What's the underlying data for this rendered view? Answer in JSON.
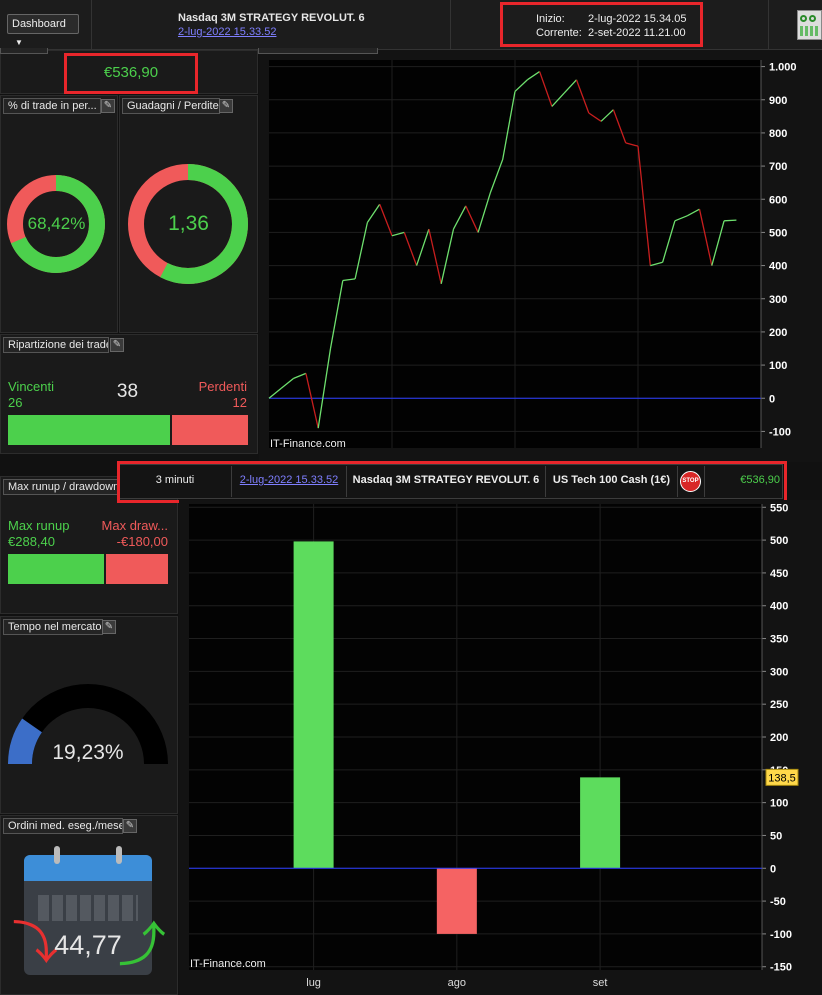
{
  "header": {
    "dashboard_label": "Dashboard",
    "strategy_name": "Nasdaq 3M STRATEGY REVOLUT. 6",
    "strategy_date": "2-lug-2022 15.33.52",
    "start_label": "Inizio:",
    "start_value": "2-lug-2022 15.34.05",
    "current_label": "Corrente:",
    "current_value": "2-set-2022 11.21.00"
  },
  "total": {
    "value": "€536,90"
  },
  "pct_trades": {
    "title": "% di trade in per...",
    "value": "68,42%",
    "fraction": 0.6842
  },
  "gain_loss": {
    "title": "Guadagni / Perdite",
    "value": "1,36",
    "fraction": 0.576
  },
  "breakdown": {
    "title": "Ripartizione dei trade",
    "win_label": "Vincenti",
    "win_count": "26",
    "total": "38",
    "lose_label": "Perdenti",
    "lose_count": "12",
    "win_fraction": 0.684
  },
  "runup": {
    "title": "Max runup / drawdown",
    "runup_label": "Max runup",
    "runup_value": "€288,40",
    "drawdown_label": "Max draw...",
    "drawdown_value": "-€180,00",
    "runup_fraction": 0.615
  },
  "time_in_market": {
    "title": "Tempo nel mercato",
    "value": "19,23%",
    "fraction": 0.1923
  },
  "orders": {
    "title": "Ordini med. eseg./mese",
    "value": "44,77"
  },
  "tooltip_row": {
    "timeframe": "3 minuti",
    "date": "2-lug-2022 15.33.52",
    "strategy": "Nasdaq 3M STRATEGY REVOLUT. 6",
    "instrument": "US Tech 100 Cash (1€)",
    "stop_icon": "stop-sign-icon",
    "value": "€536,90"
  },
  "equity_chart": {
    "watermark": "IT-Finance.com",
    "y_ticks": [
      "1.000",
      "900",
      "800",
      "700",
      "600",
      "500",
      "400",
      "300",
      "200",
      "100",
      "0",
      "-100"
    ]
  },
  "monthly_chart": {
    "watermark": "IT-Finance.com",
    "y_ticks": [
      "550",
      "500",
      "450",
      "400",
      "350",
      "300",
      "250",
      "200",
      "150",
      "100",
      "50",
      "0",
      "-50",
      "-100",
      "-150"
    ],
    "x_labels": [
      "lug",
      "ago",
      "set"
    ],
    "last_value_badge": "138,5"
  },
  "chart_data": [
    {
      "type": "line",
      "x": [
        0,
        1,
        2,
        3,
        4,
        5,
        6,
        7,
        8,
        9,
        10,
        11,
        12,
        13,
        14,
        15,
        16,
        17,
        18,
        19,
        20,
        21,
        22,
        23,
        24,
        25,
        26,
        27,
        28,
        29,
        30,
        31,
        32,
        33,
        34,
        35,
        36,
        37,
        38
      ],
      "values": [
        0,
        30,
        60,
        75,
        -90,
        150,
        355,
        360,
        530,
        585,
        490,
        500,
        400,
        510,
        345,
        510,
        580,
        500,
        620,
        720,
        925,
        960,
        985,
        880,
        920,
        960,
        860,
        835,
        870,
        770,
        760,
        400,
        410,
        535,
        550,
        570,
        400,
        535,
        537
      ],
      "ylim": [
        -150,
        1050
      ],
      "xlim": [
        0,
        40
      ],
      "colors": {
        "up": "#6ee06e",
        "down": "#c81e1e",
        "baseline": "#2a3cff"
      },
      "grid": true
    },
    {
      "type": "bar",
      "categories": [
        "lug",
        "ago",
        "set"
      ],
      "values": [
        498,
        -100,
        138.5
      ],
      "ylim": [
        -155,
        555
      ],
      "colors": {
        "positive": "#5ddc5d",
        "negative": "#f56363",
        "baseline": "#2a3cff"
      },
      "grid": true
    }
  ],
  "colors": {
    "green": "#4cd04c",
    "red": "#f05a5a",
    "gauge_blue": "#3c6ec8",
    "highlight": "#e8262b"
  }
}
